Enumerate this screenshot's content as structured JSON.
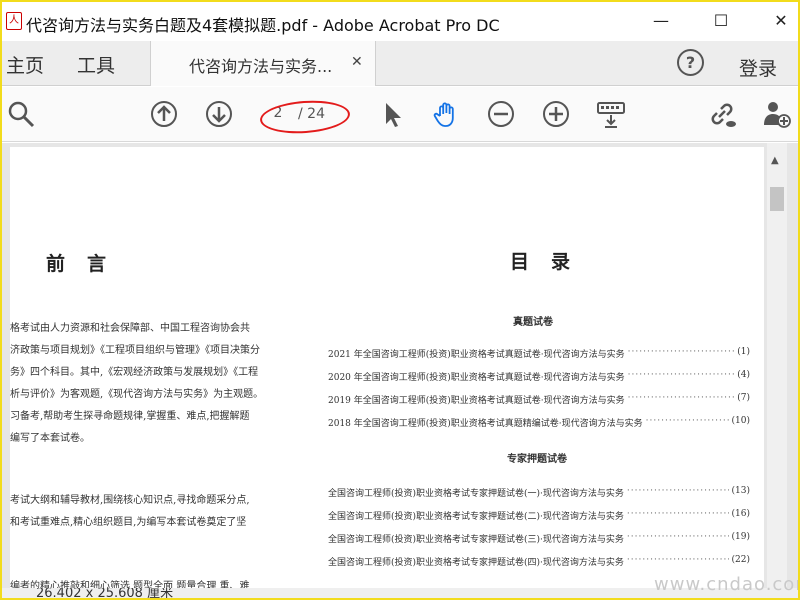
{
  "window": {
    "title": "代咨询方法与实务白题及4套模拟题.pdf - Adobe Acrobat Pro DC",
    "app_icon": "pdf-app-icon",
    "minimize": "—",
    "maximize": "☐",
    "close": "✕"
  },
  "tabs": {
    "home": "主页",
    "tools": "工具",
    "document": "代咨询方法与实务...",
    "document_close": "✕",
    "help": "?",
    "login": "登录"
  },
  "toolbar": {
    "current_page": "2",
    "total_pages": "/ 24",
    "icons": [
      "search-icon",
      "page-up-icon",
      "page-down-icon",
      "select-pointer-icon",
      "hand-tool-icon",
      "zoom-out-icon",
      "zoom-in-icon",
      "keyboard-icon",
      "share-link-icon",
      "add-user-icon"
    ],
    "annotation_color": "#e31b1b",
    "hand_tool_color": "#1473e6"
  },
  "document": {
    "preface": {
      "title": "前言",
      "lines": [
        "格考试由人力资源和社会保障部、中国工程咨询协会共",
        "济政策与项目规划》《工程项目组织与管理》《项目决策分",
        "务》四个科目。其中,《宏观经济政策与发展规划》《工程",
        "析与评价》为客观题,《现代咨询方法与实务》为主观题。",
        "习备考,帮助考生探寻命题规律,掌握重、难点,把握解题",
        "编写了本套试卷。",
        "考试大纲和辅导教材,围绕核心知识点,寻找命题采分点,",
        "和考试重难点,精心组织题目,为编写本套试卷奠定了坚",
        "编者的精心推敲和细心筛选,题型全面,题量合理,重、难"
      ]
    },
    "toc": {
      "title": "目录",
      "section_real": "真题试卷",
      "section_mock": "专家押题试卷",
      "real_entries": [
        {
          "text": "2021 年全国咨询工程师(投资)职业资格考试真题试卷·现代咨询方法与实务",
          "page": "(1)"
        },
        {
          "text": "2020 年全国咨询工程师(投资)职业资格考试真题试卷·现代咨询方法与实务",
          "page": "(4)"
        },
        {
          "text": "2019 年全国咨询工程师(投资)职业资格考试真题试卷·现代咨询方法与实务",
          "page": "(7)"
        },
        {
          "text": "2018 年全国咨询工程师(投资)职业资格考试真题精编试卷·现代咨询方法与实务",
          "page": "(10)"
        }
      ],
      "mock_entries": [
        {
          "text": "全国咨询工程师(投资)职业资格考试专家押题试卷(一)·现代咨询方法与实务",
          "page": "(13)"
        },
        {
          "text": "全国咨询工程师(投资)职业资格考试专家押题试卷(二)·现代咨询方法与实务",
          "page": "(16)"
        },
        {
          "text": "全国咨询工程师(投资)职业资格考试专家押题试卷(三)·现代咨询方法与实务",
          "page": "(19)"
        },
        {
          "text": "全国咨询工程师(投资)职业资格考试专家押题试卷(四)·现代咨询方法与实务",
          "page": "(22)"
        }
      ],
      "leader": "····································"
    }
  },
  "status": {
    "page_size": "26.402 x 25.608 厘米"
  },
  "watermark": "www.cndao.com",
  "frame_color": "#f2dc1c"
}
